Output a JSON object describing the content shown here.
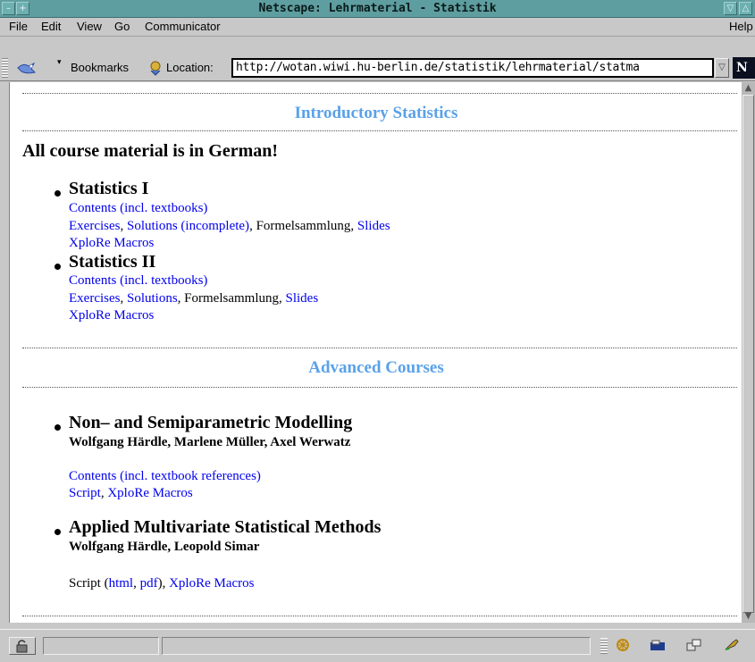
{
  "window": {
    "title": "Netscape: Lehrmaterial - Statistik"
  },
  "menu": {
    "items": [
      "File",
      "Edit",
      "View",
      "Go",
      "Communicator"
    ],
    "help": "Help"
  },
  "toolbar": {
    "bookmarks_label": "Bookmarks",
    "location_label": "Location:",
    "url": "http://wotan.wiwi.hu-berlin.de/statistik/lehrmaterial/statma",
    "logo_text": "N"
  },
  "page": {
    "intro_heading": "Introductory Statistics",
    "notice": "All course material is in German!",
    "stat1": {
      "title": "Statistics I",
      "contents": "Contents (incl. textbooks)",
      "exercises": "Exercises",
      "sep1": ", ",
      "solutions": "Solutions (incomplete)",
      "sep2": ", ",
      "formel": "Formelsammlung",
      "sep3": ", ",
      "slides": "Slides",
      "xplore": "XploRe Macros"
    },
    "stat2": {
      "title": "Statistics II",
      "contents": "Contents (incl. textbooks)",
      "exercises": "Exercises",
      "sep1": ", ",
      "solutions": "Solutions",
      "sep2": ", ",
      "formel": "Formelsammlung",
      "sep3": ", ",
      "slides": "Slides",
      "xplore": "XploRe Macros"
    },
    "advanced_heading": "Advanced Courses",
    "nonpar": {
      "title": "Non– and Semiparametric Modelling",
      "authors": "Wolfgang Härdle, Marlene Müller, Axel Werwatz",
      "contents": "Contents (incl. textbook references)",
      "script": "Script",
      "sep": ", ",
      "xplore": "XploRe Macros"
    },
    "multivar": {
      "title": "Applied Multivariate Statistical Methods",
      "authors": "Wolfgang Härdle, Leopold Simar",
      "script_prefix": "Script (",
      "html": "html",
      "sep1": ", ",
      "pdf": "pdf",
      "sep2": "), ",
      "xplore": "XploRe Macros"
    }
  },
  "colors": {
    "heading": "#5aa2e8",
    "link": "#0000ee",
    "titlebar": "#5f9ea0"
  }
}
